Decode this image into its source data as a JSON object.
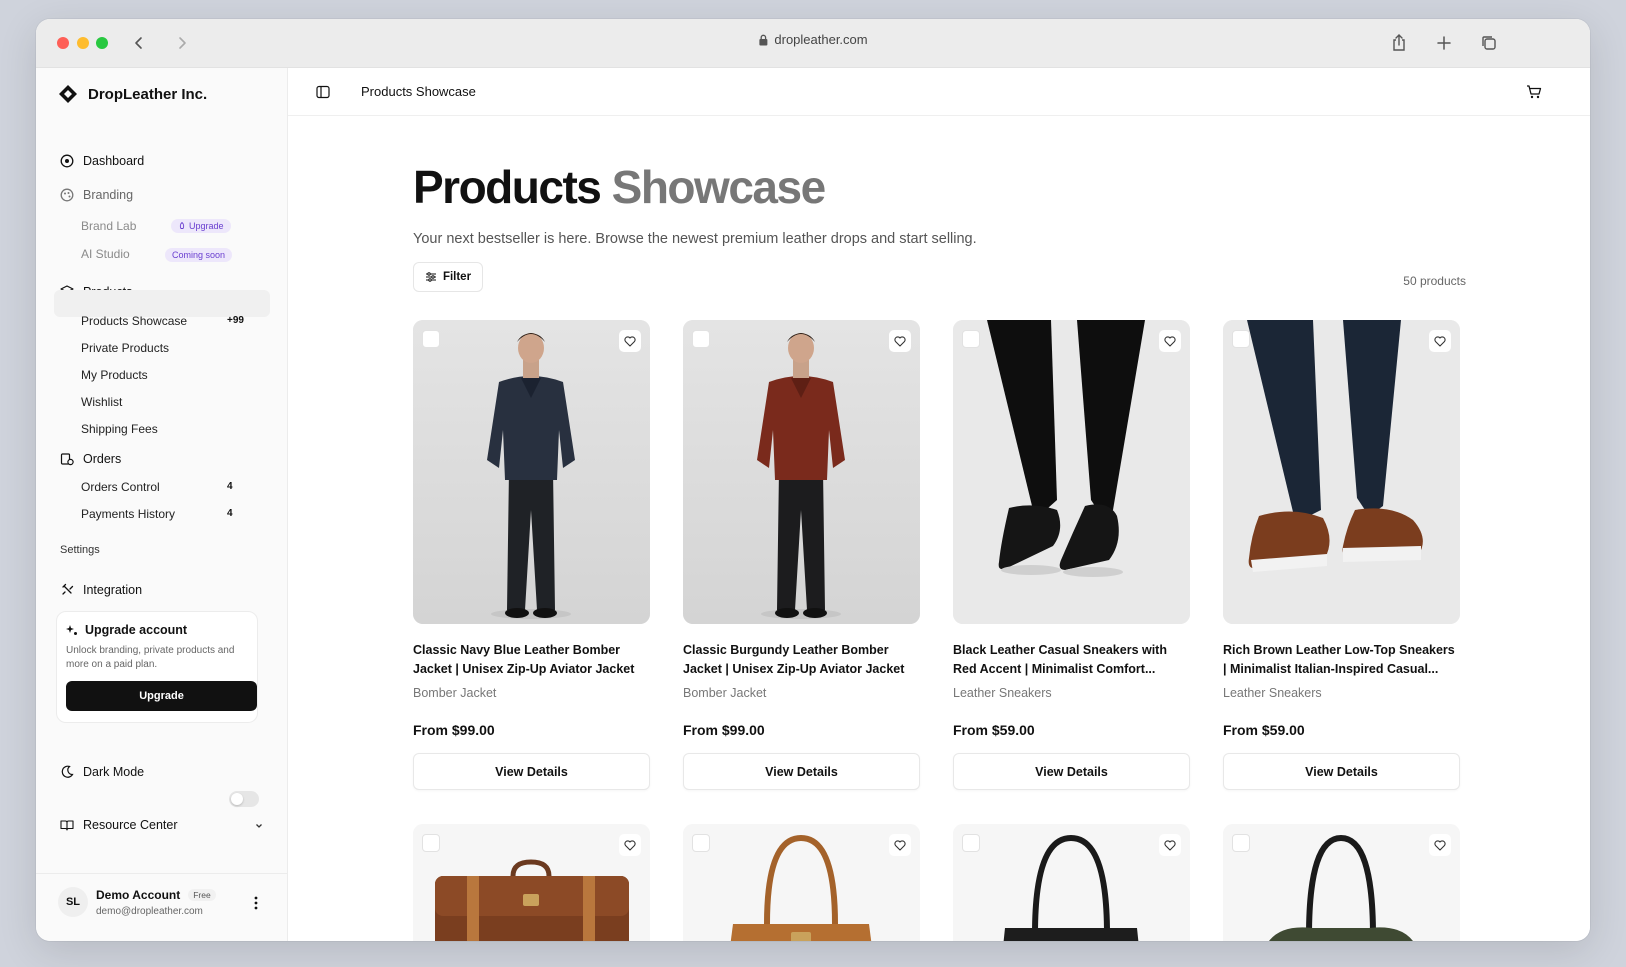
{
  "browser": {
    "url": "dropleather.com"
  },
  "sidebar": {
    "brand": "DropLeather Inc.",
    "dashboard": "Dashboard",
    "branding": "Branding",
    "brand_lab": "Brand Lab",
    "brand_lab_badge": "Upgrade",
    "ai_studio": "AI Studio",
    "ai_studio_badge": "Coming soon",
    "products": "Products",
    "products_showcase": "Products Showcase",
    "products_showcase_count": "+99",
    "private_products": "Private Products",
    "my_products": "My Products",
    "wishlist": "Wishlist",
    "shipping_fees": "Shipping Fees",
    "orders": "Orders",
    "orders_control": "Orders Control",
    "orders_control_count": "4",
    "payments_history": "Payments History",
    "payments_history_count": "4",
    "settings_label": "Settings",
    "integration": "Integration",
    "upgrade_card": {
      "title": "Upgrade account",
      "desc": "Unlock branding, private products and more on a paid plan.",
      "button": "Upgrade"
    },
    "dark_mode": "Dark Mode",
    "resource_center": "Resource Center",
    "account": {
      "initials": "SL",
      "name": "Demo Account",
      "plan": "Free",
      "email": "demo@dropleather.com"
    }
  },
  "topbar": {
    "title": "Products Showcase"
  },
  "page": {
    "heading_dark": "Products",
    "heading_light": "Showcase",
    "subtitle": "Your next bestseller is here. Browse the newest premium leather drops and start selling.",
    "filter": "Filter",
    "count": "50 products"
  },
  "products": [
    {
      "title": "Classic Navy Blue Leather Bomber Jacket | Unisex Zip-Up Aviator Jacket",
      "category": "Bomber Jacket",
      "price": "From $99.00",
      "button": "View Details"
    },
    {
      "title": "Classic Burgundy Leather Bomber Jacket | Unisex Zip-Up Aviator Jacket",
      "category": "Bomber Jacket",
      "price": "From $99.00",
      "button": "View Details"
    },
    {
      "title": "Black Leather Casual Sneakers with Red Accent | Minimalist Comfort...",
      "category": "Leather Sneakers",
      "price": "From $59.00",
      "button": "View Details"
    },
    {
      "title": "Rich Brown Leather Low-Top Sneakers | Minimalist Italian-Inspired Casual...",
      "category": "Leather Sneakers",
      "price": "From $59.00",
      "button": "View Details"
    }
  ],
  "colors": {
    "accent_purple": "#6a3fd0",
    "button_dark": "#111111"
  }
}
